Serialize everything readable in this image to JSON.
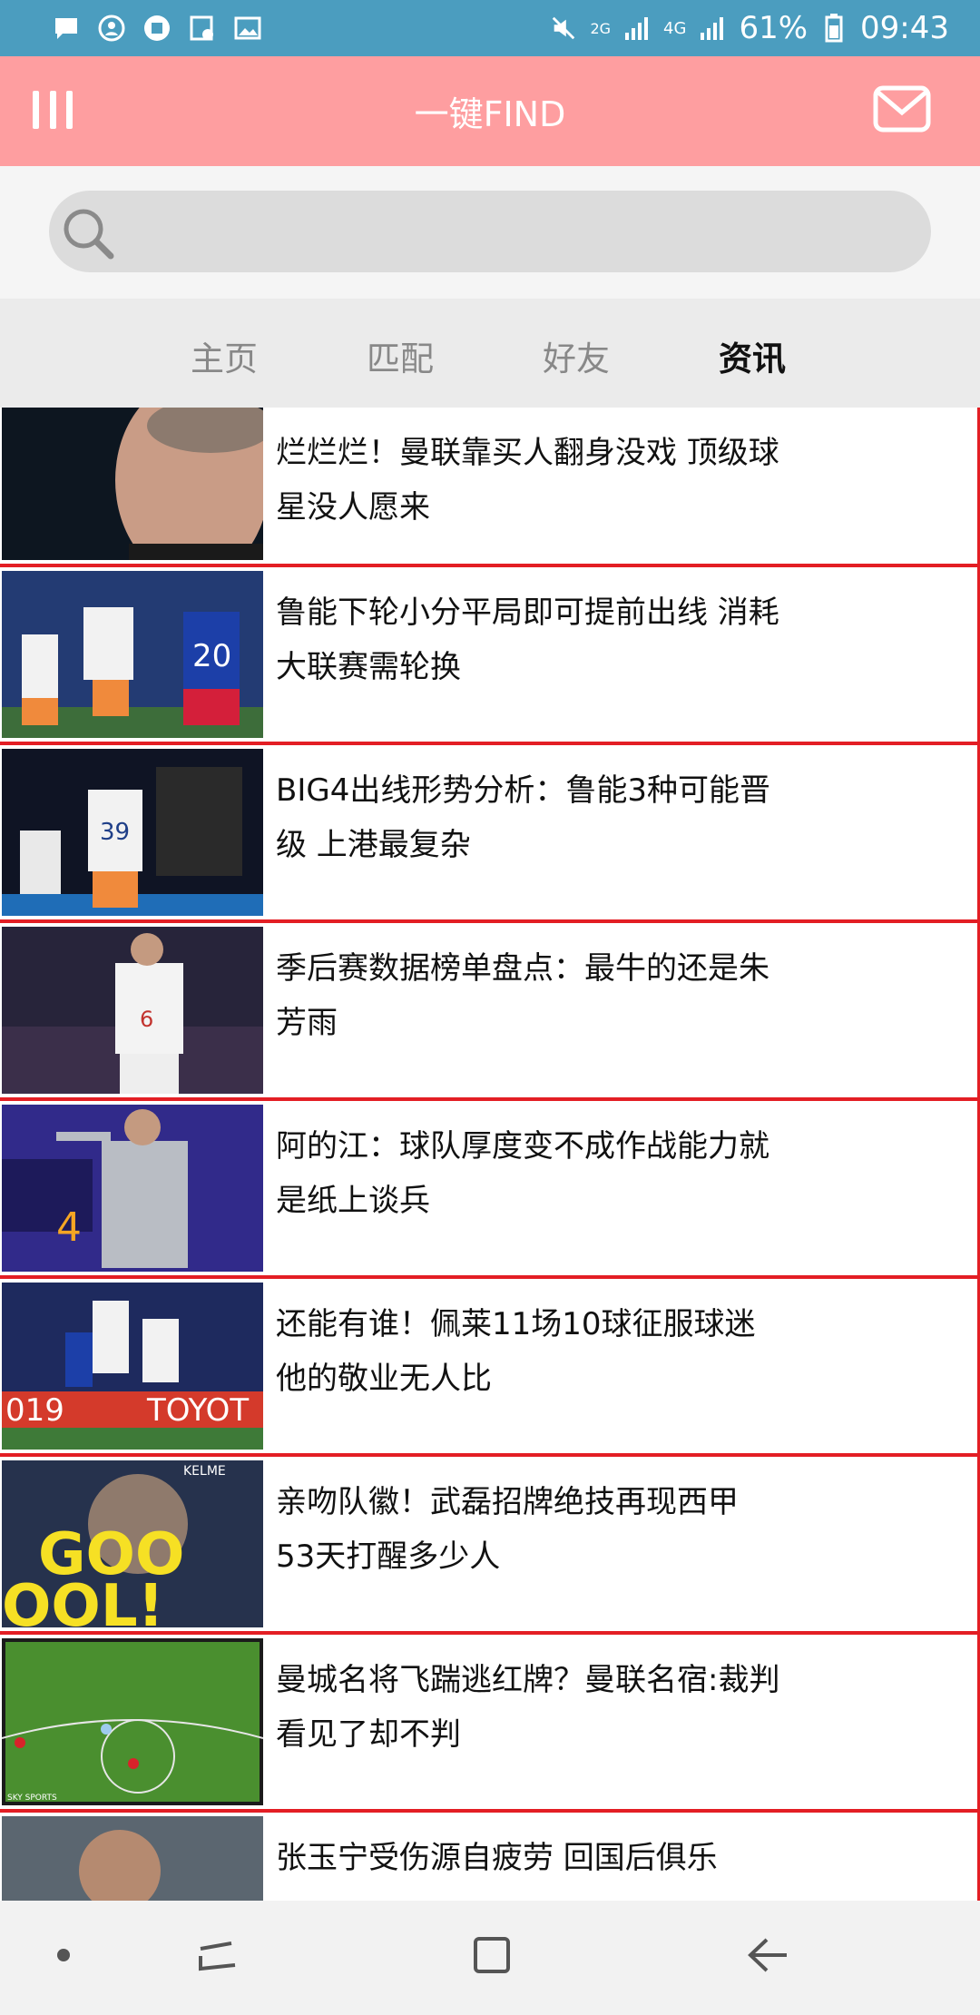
{
  "status_bar": {
    "battery": "61%",
    "time": "09:43",
    "network_1": "2G",
    "network_2": "4G",
    "icons": [
      "message-icon",
      "account-icon",
      "zhihu-icon",
      "calendar-icon",
      "gallery-icon",
      "mute-icon",
      "signal-icon",
      "signal-icon",
      "battery-icon"
    ]
  },
  "app_bar": {
    "title": "一键FIND",
    "menu_icon": "menu-icon",
    "mail_icon": "mail-icon",
    "color": "#fe9ea0"
  },
  "search": {
    "placeholder": "",
    "icon": "search-icon"
  },
  "tabs": [
    {
      "label": "主页",
      "active": false
    },
    {
      "label": "匹配",
      "active": false
    },
    {
      "label": "好友",
      "active": false
    },
    {
      "label": "资讯",
      "active": true
    }
  ],
  "news": [
    {
      "title": "烂烂烂！曼联靠买人翻身没戏 顶级球星没人愿来"
    },
    {
      "title": "鲁能下轮小分平局即可提前出线 消耗大联赛需轮换"
    },
    {
      "title": "BIG4出线形势分析：鲁能3种可能晋级 上港最复杂"
    },
    {
      "title": "季后赛数据榜单盘点：最牛的还是朱芳雨"
    },
    {
      "title": "阿的江：球队厚度变不成作战能力就是纸上谈兵"
    },
    {
      "title": "还能有谁！佩莱11场10球征服球迷 他的敬业无人比"
    },
    {
      "title": "亲吻队徽！武磊招牌绝技再现西甲 53天打醒多少人"
    },
    {
      "title": "曼城名将飞踹逃红牌？曼联名宿:裁判看见了却不判"
    },
    {
      "title": "张玉宁受伤源自疲劳 回国后俱乐"
    }
  ],
  "thumb_texts": {
    "kelme": "KELME",
    "goal": "GOO",
    "goal2": "OOL!",
    "jersey_20": "20",
    "jersey_39": "39",
    "jersey_6": "6",
    "score_4": "4",
    "year_2019": "019",
    "toyota": "TOYOT",
    "sky": "SKY SPORTS"
  },
  "nav_bar": {
    "icons": [
      "dot-icon",
      "recent-apps-icon",
      "home-icon",
      "back-icon"
    ]
  },
  "colors": {
    "status_bar": "#4b9dbf",
    "accent_border": "#e31e24",
    "tab_bar": "#ebebeb"
  }
}
